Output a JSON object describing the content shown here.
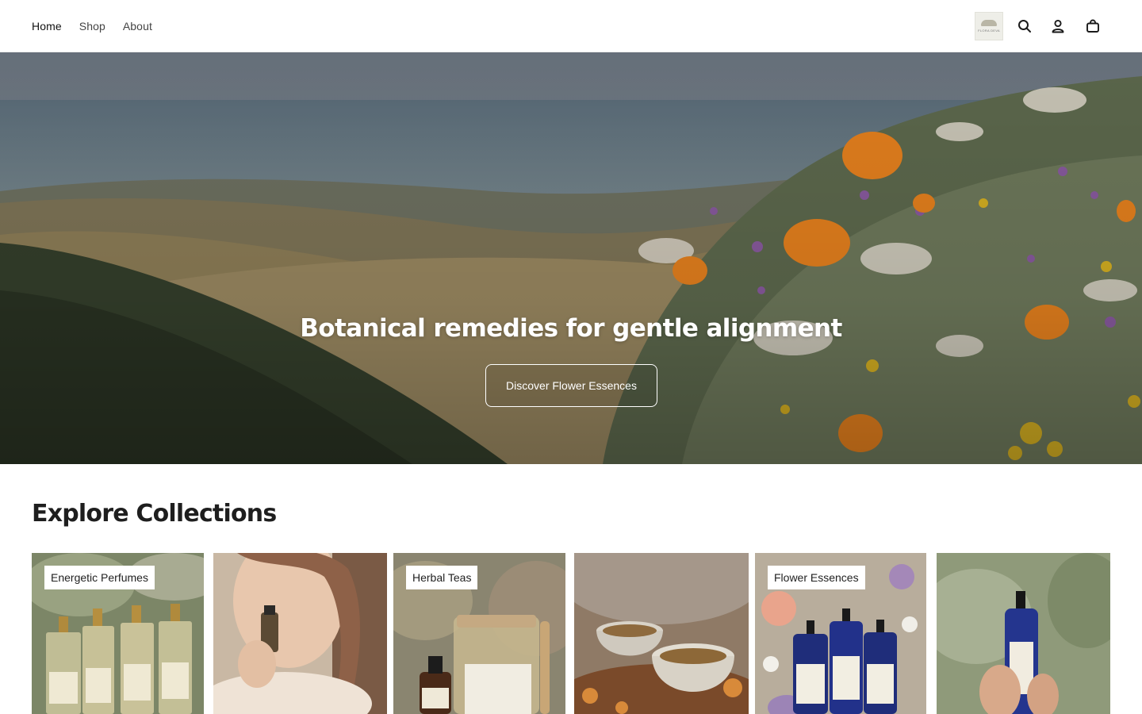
{
  "nav": {
    "links": [
      {
        "label": "Home"
      },
      {
        "label": "Shop"
      },
      {
        "label": "About"
      }
    ]
  },
  "header": {
    "logo_text": "FLORA DEVA",
    "icons": [
      "search-icon",
      "account-icon",
      "cart-icon"
    ]
  },
  "hero": {
    "title": "Botanical remedies for gentle alignment",
    "button_label": "Discover Flower Essences"
  },
  "collections": {
    "title": "Explore Collections",
    "cards": [
      {
        "label": "Energetic Perfumes"
      },
      {
        "label": ""
      },
      {
        "label": "Herbal Teas"
      },
      {
        "label": ""
      },
      {
        "label": "Flower Essences"
      },
      {
        "label": ""
      }
    ]
  },
  "colors": {
    "text": "#1e1e1e",
    "nav_text": "#444444",
    "button_border": "#ffffff",
    "poppy_orange": "#e8821e"
  }
}
